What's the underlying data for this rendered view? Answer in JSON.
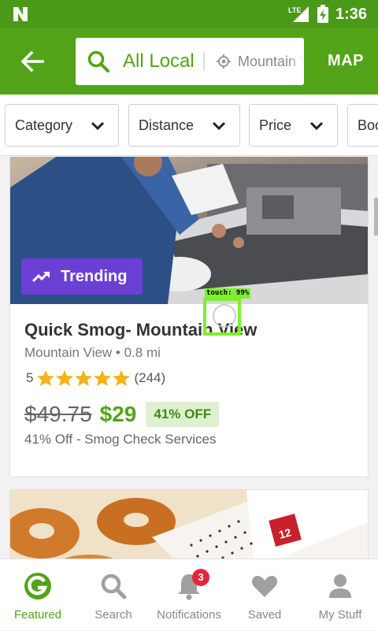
{
  "status": {
    "time": "1:36",
    "network": "LTE"
  },
  "appbar": {
    "search_query": "All Local",
    "location": "Mountain View",
    "map_label": "MAP"
  },
  "filters": [
    "Category",
    "Distance",
    "Price",
    "Book"
  ],
  "deal1": {
    "badge": "Trending",
    "title": "Quick Smog- Mountain View",
    "location_distance": "Mountain View • 0.8 mi",
    "rating": "5",
    "rating_value": 5,
    "reviews": "(244)",
    "old_price": "$49.75",
    "new_price": "$29",
    "discount": "41% OFF",
    "description": "41% Off - Smog Check Services"
  },
  "touch": {
    "label": "touch: 99%"
  },
  "nav": {
    "items": [
      {
        "label": "Featured",
        "icon": "groupon-g-icon"
      },
      {
        "label": "Search",
        "icon": "search-icon"
      },
      {
        "label": "Notifications",
        "icon": "bell-icon"
      },
      {
        "label": "Saved",
        "icon": "heart-icon"
      },
      {
        "label": "My Stuff",
        "icon": "person-icon"
      }
    ],
    "notifications_count": "3"
  },
  "colors": {
    "brand": "#53a318",
    "status_bar": "#4a9a1a",
    "trending": "#6b3fd4",
    "badge": "#e0283c"
  }
}
